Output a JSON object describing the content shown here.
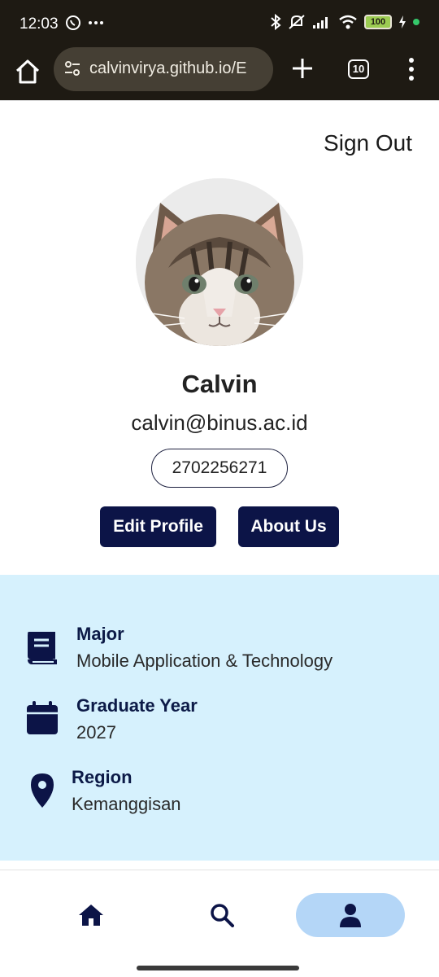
{
  "status_bar": {
    "time": "12:03",
    "battery": "100",
    "icons": [
      "whatsapp-icon",
      "more-dots-icon",
      "bluetooth-icon",
      "mute-icon",
      "signal-icon",
      "wifi-icon",
      "battery-icon",
      "charging-icon"
    ]
  },
  "browser": {
    "url": "calvinvirya.github.io/E",
    "tab_count": "10"
  },
  "header": {
    "signout_label": "Sign Out"
  },
  "profile": {
    "name": "Calvin",
    "email": "calvin@binus.ac.id",
    "student_id": "2702256271",
    "edit_label": "Edit Profile",
    "about_label": "About Us"
  },
  "info": {
    "major_title": "Major",
    "major_value": "Mobile Application & Technology",
    "grad_title": "Graduate Year",
    "grad_value": "2027",
    "region_title": "Region",
    "region_value": "Kemanggisan"
  },
  "colors": {
    "primary": "#0c1447",
    "info_bg": "#d6f1fd",
    "nav_active": "#b4d6f7",
    "browser_bg": "#1e1a13"
  }
}
